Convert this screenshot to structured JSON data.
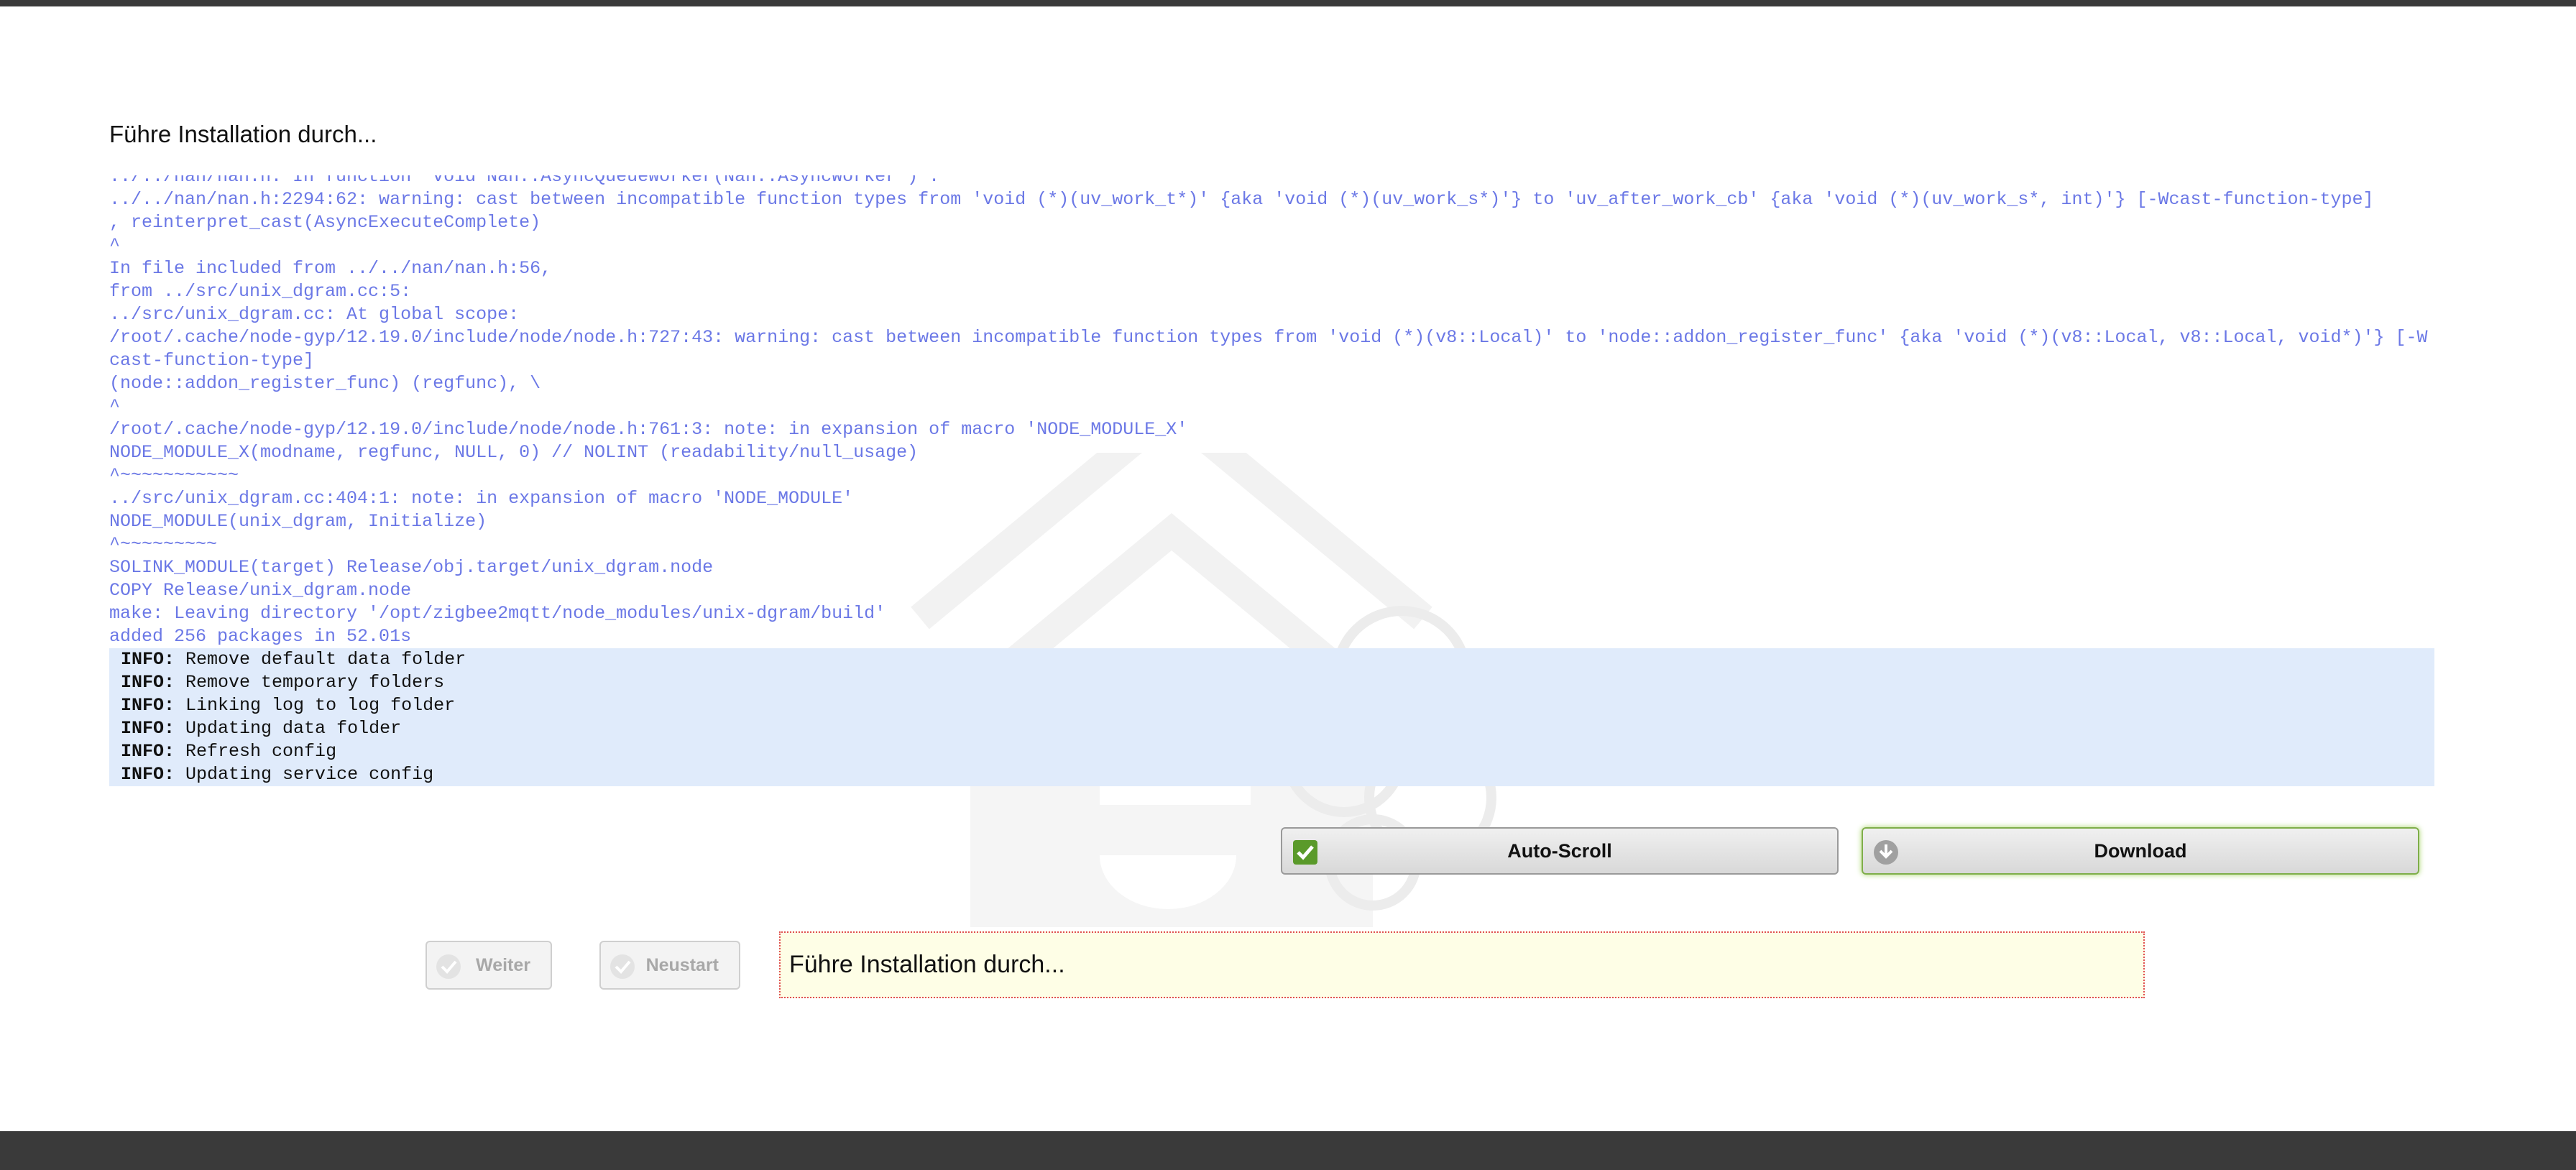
{
  "page": {
    "title": "Führe Installation durch..."
  },
  "log": {
    "lines": [
      "../../nan/nan.h: In function 'void Nan::AsyncQueueWorker(Nan::AsyncWorker*)':",
      "../../nan/nan.h:2294:62: warning: cast between incompatible function types from 'void (*)(uv_work_t*)' {aka 'void (*)(uv_work_s*)'} to 'uv_after_work_cb' {aka 'void (*)(uv_work_s*, int)'} [-Wcast-function-type]",
      ", reinterpret_cast(AsyncExecuteComplete)",
      "^",
      "In file included from ../../nan/nan.h:56,",
      "from ../src/unix_dgram.cc:5:",
      "../src/unix_dgram.cc: At global scope:",
      "/root/.cache/node-gyp/12.19.0/include/node/node.h:727:43: warning: cast between incompatible function types from 'void (*)(v8::Local)' to 'node::addon_register_func' {aka 'void (*)(v8::Local, v8::Local, void*)'} [-Wcast-function-type]",
      "(node::addon_register_func) (regfunc), \\",
      "^",
      "/root/.cache/node-gyp/12.19.0/include/node/node.h:761:3: note: in expansion of macro 'NODE_MODULE_X'",
      "NODE_MODULE_X(modname, regfunc, NULL, 0) // NOLINT (readability/null_usage)",
      "^~~~~~~~~~~~",
      "../src/unix_dgram.cc:404:1: note: in expansion of macro 'NODE_MODULE'",
      "NODE_MODULE(unix_dgram, Initialize)",
      "^~~~~~~~~~",
      "SOLINK_MODULE(target) Release/obj.target/unix_dgram.node",
      "COPY Release/unix_dgram.node",
      "make: Leaving directory '/opt/zigbee2mqtt/node_modules/unix-dgram/build'",
      "added 256 packages in 52.01s"
    ],
    "info_prefix": "INFO:",
    "info_lines": [
      "Remove default data folder",
      "Remove temporary folders",
      "Linking log to log folder",
      "Updating data folder",
      "Refresh config",
      "Updating service config"
    ]
  },
  "buttons": {
    "autoscroll": "Auto-Scroll",
    "download": "Download",
    "weiter": "Weiter",
    "neustart": "Neustart"
  },
  "status": "Führe Installation durch...",
  "colors": {
    "log_text": "#6b78e6",
    "info_bg": "#e0ebfb",
    "status_bg": "#fefee6",
    "status_border": "#e05050",
    "checkbox_green": "#5a9a2a",
    "frame_dark": "#3a3a3a"
  }
}
